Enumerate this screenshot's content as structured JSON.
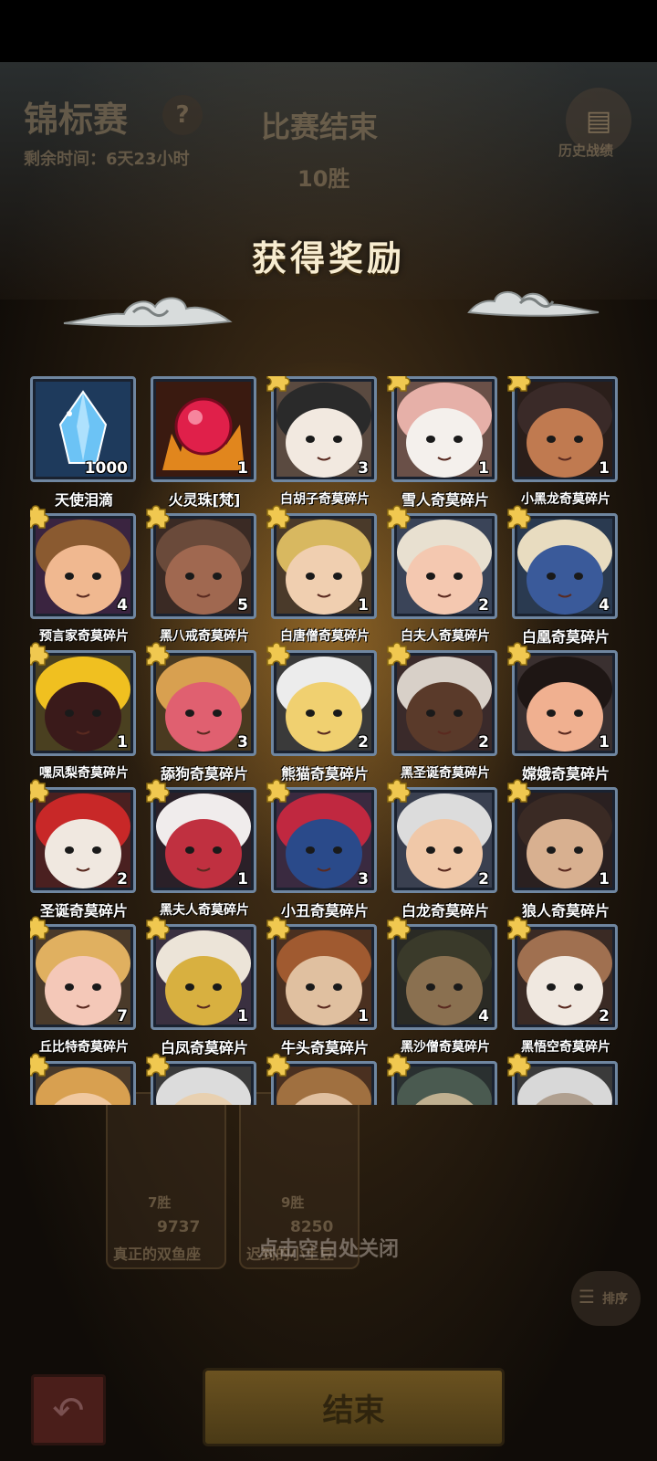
{
  "background": {
    "event_title": "锦标赛",
    "help_mark": "?",
    "remaining_time": "剩余时间：6天23小时",
    "match_status": "比赛结束",
    "wins": "10胜",
    "history_label": "历史战绩",
    "cards": [
      {
        "wins": "7胜",
        "score": "9737",
        "name": "真正的双鱼座"
      },
      {
        "wins": "9胜",
        "score": "8250",
        "name": "迟到的小土豆"
      }
    ],
    "sort_label": "排序",
    "end_button": "结束"
  },
  "overlay": {
    "title": "获得奖励",
    "close_hint": "点击空白处关闭"
  },
  "rewards": [
    {
      "name": "天使泪滴",
      "count": "1000",
      "shard": false,
      "bg": "#1e3a5c",
      "c1": "#bfe8ff",
      "c2": "#6cc3f5"
    },
    {
      "name": "火灵珠[梵]",
      "count": "1",
      "shard": false,
      "bg": "#3a1a10",
      "c1": "#e0204a",
      "c2": "#ff9a20"
    },
    {
      "name": "白胡子奇莫碎片",
      "count": "3",
      "shard": true,
      "bg": "#5a4a40",
      "c1": "#2a2a2a",
      "c2": "#f2e9e0"
    },
    {
      "name": "雪人奇莫碎片",
      "count": "1",
      "shard": true,
      "bg": "#6a5048",
      "c1": "#e6b0a8",
      "c2": "#f4f0ec"
    },
    {
      "name": "小黑龙奇莫碎片",
      "count": "1",
      "shard": true,
      "bg": "#2a1e1a",
      "c1": "#3a2a28",
      "c2": "#c07a50"
    },
    {
      "name": "预言家奇莫碎片",
      "count": "4",
      "shard": true,
      "bg": "#3a2440",
      "c1": "#8a5a30",
      "c2": "#f0b890"
    },
    {
      "name": "黑八戒奇莫碎片",
      "count": "5",
      "shard": true,
      "bg": "#3a2a24",
      "c1": "#6a4a3a",
      "c2": "#a06850"
    },
    {
      "name": "白唐僧奇莫碎片",
      "count": "1",
      "shard": true,
      "bg": "#4a3a2a",
      "c1": "#d8b860",
      "c2": "#f0cfb0"
    },
    {
      "name": "白夫人奇莫碎片",
      "count": "2",
      "shard": true,
      "bg": "#3a4458",
      "c1": "#e8e0d0",
      "c2": "#f4c8b0"
    },
    {
      "name": "白凰奇莫碎片",
      "count": "4",
      "shard": true,
      "bg": "#2a3a50",
      "c1": "#e8dcc0",
      "c2": "#3a5a9a"
    },
    {
      "name": "嘿凤梨奇莫碎片",
      "count": "1",
      "shard": true,
      "bg": "#4a4020",
      "c1": "#f0c020",
      "c2": "#3a1a1a"
    },
    {
      "name": "舔狗奇莫碎片",
      "count": "3",
      "shard": true,
      "bg": "#4a3a20",
      "c1": "#d8a050",
      "c2": "#e06070"
    },
    {
      "name": "熊猫奇莫碎片",
      "count": "2",
      "shard": true,
      "bg": "#3a3a3a",
      "c1": "#ececec",
      "c2": "#f0d070"
    },
    {
      "name": "黑圣诞奇莫碎片",
      "count": "2",
      "shard": true,
      "bg": "#3a2a2a",
      "c1": "#d8d0c8",
      "c2": "#5a3a2a"
    },
    {
      "name": "嫦娥奇莫碎片",
      "count": "1",
      "shard": true,
      "bg": "#3a3030",
      "c1": "#1e1614",
      "c2": "#f0b090"
    },
    {
      "name": "圣诞奇莫碎片",
      "count": "2",
      "shard": true,
      "bg": "#4a2020",
      "c1": "#c82828",
      "c2": "#f0e8e0"
    },
    {
      "name": "黑夫人奇莫碎片",
      "count": "1",
      "shard": true,
      "bg": "#2a2028",
      "c1": "#f0ecec",
      "c2": "#c03040"
    },
    {
      "name": "小丑奇莫碎片",
      "count": "3",
      "shard": true,
      "bg": "#3a2a40",
      "c1": "#c02840",
      "c2": "#2a4a8a"
    },
    {
      "name": "白龙奇莫碎片",
      "count": "2",
      "shard": true,
      "bg": "#3a4050",
      "c1": "#dcdcdc",
      "c2": "#f0c8a8"
    },
    {
      "name": "狼人奇莫碎片",
      "count": "1",
      "shard": true,
      "bg": "#2a2020",
      "c1": "#3a2a24",
      "c2": "#d8b090"
    },
    {
      "name": "丘比特奇莫碎片",
      "count": "7",
      "shard": true,
      "bg": "#4a3a2a",
      "c1": "#e0b060",
      "c2": "#f4c8b8"
    },
    {
      "name": "白凤奇莫碎片",
      "count": "1",
      "shard": true,
      "bg": "#3a3040",
      "c1": "#ece4d8",
      "c2": "#d8b040"
    },
    {
      "name": "牛头奇莫碎片",
      "count": "1",
      "shard": true,
      "bg": "#4a3020",
      "c1": "#a05a30",
      "c2": "#e0c0a0"
    },
    {
      "name": "黑沙僧奇莫碎片",
      "count": "4",
      "shard": true,
      "bg": "#2a2a24",
      "c1": "#3a3a2a",
      "c2": "#8a7050"
    },
    {
      "name": "黑悟空奇莫碎片",
      "count": "2",
      "shard": true,
      "bg": "#3a2a24",
      "c1": "#a07050",
      "c2": "#f0e8e0"
    },
    {
      "name": "",
      "count": "",
      "shard": true,
      "bg": "#4a3a2a",
      "c1": "#d8a050",
      "c2": "#f0c8a0"
    },
    {
      "name": "",
      "count": "",
      "shard": true,
      "bg": "#3a3a3a",
      "c1": "#dcdcdc",
      "c2": "#e8d0b0"
    },
    {
      "name": "",
      "count": "",
      "shard": true,
      "bg": "#4a3020",
      "c1": "#a07040",
      "c2": "#e0c0a0"
    },
    {
      "name": "",
      "count": "",
      "shard": true,
      "bg": "#2a3030",
      "c1": "#4a5a50",
      "c2": "#c0b090"
    },
    {
      "name": "",
      "count": "",
      "shard": true,
      "bg": "#3a3a3a",
      "c1": "#d8d8d8",
      "c2": "#b0a090"
    }
  ],
  "colors": {
    "frame_border": "#6f86a0",
    "puzzle_gold": "#f0c850",
    "title_text": "#f7ecd0"
  }
}
